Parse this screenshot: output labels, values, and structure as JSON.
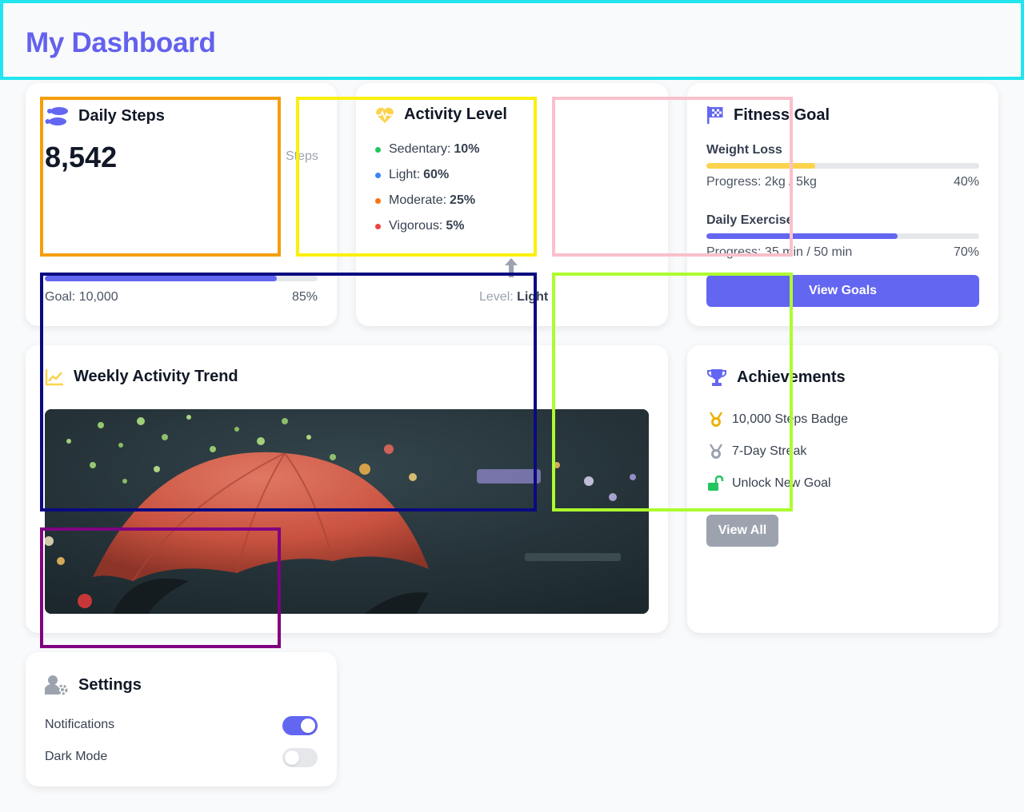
{
  "header": {
    "title": "My Dashboard"
  },
  "daily_steps": {
    "title": "Daily Steps",
    "count": "8,542",
    "unit": "Steps",
    "goal_label": "Goal: 10,000",
    "percent_label": "85%",
    "progress": 0.85
  },
  "activity_level": {
    "title": "Activity Level",
    "items": [
      {
        "name": "Sedentary:",
        "value": "10%",
        "color": "#22c55e"
      },
      {
        "name": "Light:",
        "value": "60%",
        "color": "#3b82f6"
      },
      {
        "name": "Moderate:",
        "value": "25%",
        "color": "#f97316"
      },
      {
        "name": "Vigorous:",
        "value": "5%",
        "color": "#ef4444"
      }
    ],
    "level_prefix": "Level:",
    "level_value": "Light"
  },
  "fitness_goal": {
    "title": "Fitness Goal",
    "goals": [
      {
        "name": "Weight Loss",
        "progress_text": "Progress: 2kg / 5kg",
        "percent_label": "40%",
        "progress": 0.4,
        "color": "#fcd34d"
      },
      {
        "name": "Daily Exercise",
        "progress_text": "Progress: 35 min / 50 min",
        "percent_label": "70%",
        "progress": 0.7,
        "color": "#6366f1"
      }
    ],
    "button_label": "View Goals"
  },
  "weekly_trend": {
    "title": "Weekly Activity Trend"
  },
  "achievements": {
    "title": "Achievements",
    "items": [
      {
        "label": "10,000 Steps Badge",
        "icon": "gold-medal-icon"
      },
      {
        "label": "7-Day Streak",
        "icon": "silver-medal-icon"
      },
      {
        "label": "Unlock New Goal",
        "icon": "unlock-icon"
      }
    ],
    "button_label": "View All"
  },
  "settings": {
    "title": "Settings",
    "items": [
      {
        "label": "Notifications",
        "enabled": true
      },
      {
        "label": "Dark Mode",
        "enabled": false
      }
    ]
  },
  "colors": {
    "accent": "#6366f1",
    "title_color": "#6361ee",
    "yellow": "#fcd34d",
    "muted_button": "#9ca3af"
  }
}
